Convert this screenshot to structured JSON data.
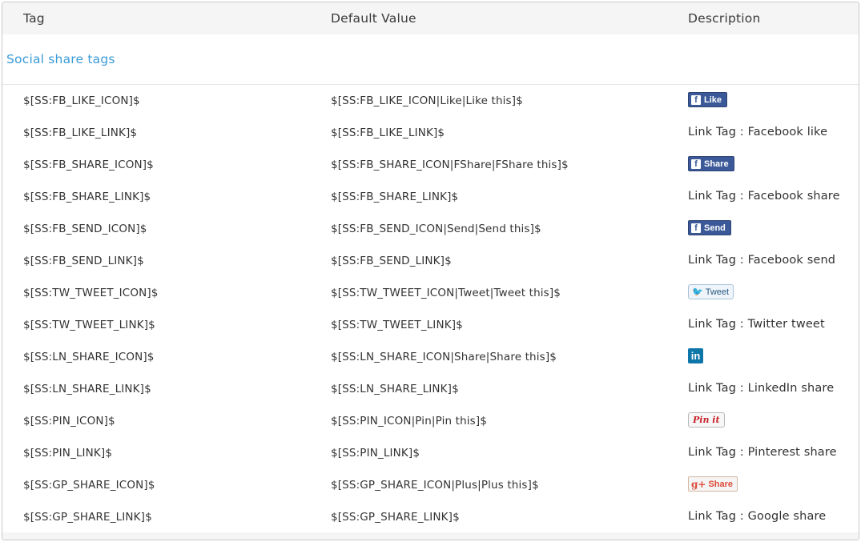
{
  "header": {
    "col_tag": "Tag",
    "col_default": "Default Value",
    "col_desc": "Description"
  },
  "section": {
    "title": "Social share tags"
  },
  "rows": [
    {
      "tag": "$[SS:FB_LIKE_ICON]$",
      "default": "$[SS:FB_LIKE_ICON|Like|Like this]$",
      "desc_type": "badge",
      "badge": {
        "style": "facebook",
        "icon": "facebook-f-icon",
        "glyph": "f",
        "label": "Like"
      }
    },
    {
      "tag": "$[SS:FB_LIKE_LINK]$",
      "default": "$[SS:FB_LIKE_LINK]$",
      "desc_type": "text",
      "desc": "Link Tag : Facebook like"
    },
    {
      "tag": "$[SS:FB_SHARE_ICON]$",
      "default": "$[SS:FB_SHARE_ICON|FShare|FShare this]$",
      "desc_type": "badge",
      "badge": {
        "style": "facebook",
        "icon": "facebook-f-icon",
        "glyph": "f",
        "label": "Share"
      }
    },
    {
      "tag": "$[SS:FB_SHARE_LINK]$",
      "default": "$[SS:FB_SHARE_LINK]$",
      "desc_type": "text",
      "desc": "Link Tag : Facebook share"
    },
    {
      "tag": "$[SS:FB_SEND_ICON]$",
      "default": "$[SS:FB_SEND_ICON|Send|Send this]$",
      "desc_type": "badge",
      "badge": {
        "style": "facebook",
        "icon": "facebook-f-icon",
        "glyph": "f",
        "label": "Send"
      }
    },
    {
      "tag": "$[SS:FB_SEND_LINK]$",
      "default": "$[SS:FB_SEND_LINK]$",
      "desc_type": "text",
      "desc": "Link Tag : Facebook send"
    },
    {
      "tag": "$[SS:TW_TWEET_ICON]$",
      "default": "$[SS:TW_TWEET_ICON|Tweet|Tweet this]$",
      "desc_type": "badge",
      "badge": {
        "style": "twitter",
        "icon": "twitter-bird-icon",
        "glyph": "🐦",
        "label": "Tweet"
      }
    },
    {
      "tag": "$[SS:TW_TWEET_LINK]$",
      "default": "$[SS:TW_TWEET_LINK]$",
      "desc_type": "text",
      "desc": "Link Tag : Twitter tweet"
    },
    {
      "tag": "$[SS:LN_SHARE_ICON]$",
      "default": "$[SS:LN_SHARE_ICON|Share|Share this]$",
      "desc_type": "badge",
      "badge": {
        "style": "linkedin",
        "icon": "linkedin-icon",
        "glyph": "",
        "label": "in"
      }
    },
    {
      "tag": "$[SS:LN_SHARE_LINK]$",
      "default": "$[SS:LN_SHARE_LINK]$",
      "desc_type": "text",
      "desc": "Link Tag : LinkedIn share"
    },
    {
      "tag": "$[SS:PIN_ICON]$",
      "default": "$[SS:PIN_ICON|Pin|Pin this]$",
      "desc_type": "badge",
      "badge": {
        "style": "pinterest",
        "icon": "pinterest-pinit-icon",
        "glyph": "",
        "label": "Pin it"
      }
    },
    {
      "tag": "$[SS:PIN_LINK]$",
      "default": "$[SS:PIN_LINK]$",
      "desc_type": "text",
      "desc": "Link Tag : Pinterest share"
    },
    {
      "tag": "$[SS:GP_SHARE_ICON]$",
      "default": "$[SS:GP_SHARE_ICON|Plus|Plus this]$",
      "desc_type": "badge",
      "badge": {
        "style": "googleplus",
        "icon": "google-plus-icon",
        "glyph": "g+",
        "label": "Share"
      }
    },
    {
      "tag": "$[SS:GP_SHARE_LINK]$",
      "default": "$[SS:GP_SHARE_LINK]$",
      "desc_type": "text",
      "desc": "Link Tag : Google share"
    }
  ],
  "colors": {
    "section_title": "#3a9bd7",
    "header_bg": "#f5f5f5",
    "facebook": "#3b5998",
    "linkedin": "#0e76a8",
    "pinterest": "#c8232c",
    "googleplus": "#dd4b39",
    "twitter": "#2aa9e0"
  }
}
